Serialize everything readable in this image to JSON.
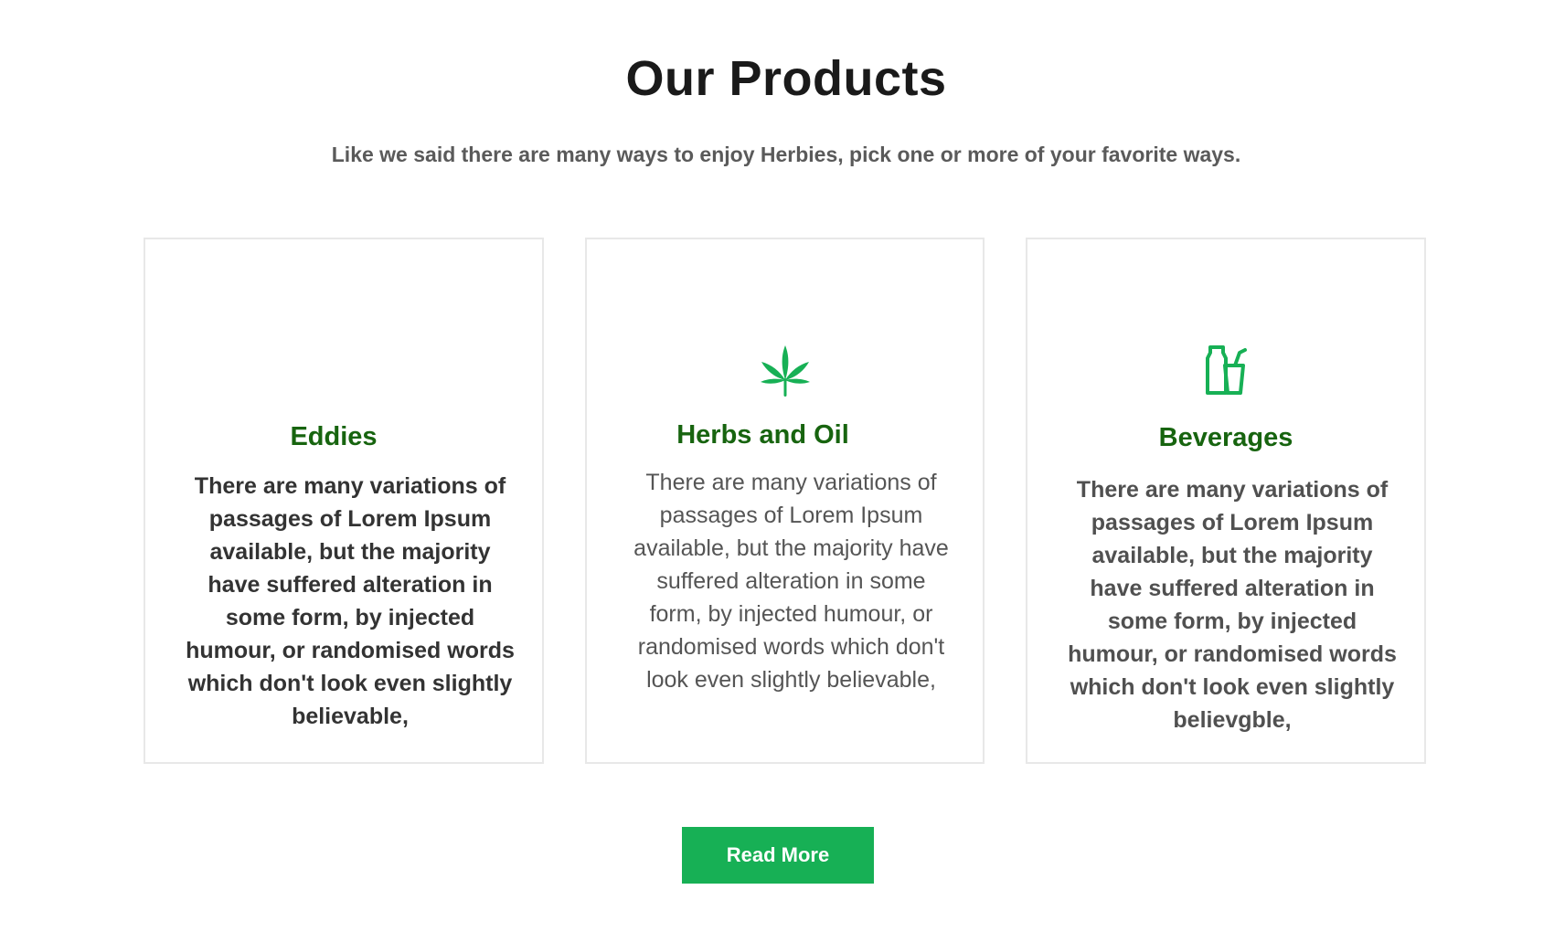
{
  "header": {
    "title": "Our Products",
    "subtitle": "Like we said there are many ways to enjoy Herbies, pick one or more of your favorite ways."
  },
  "colors": {
    "accent": "#17b055",
    "card_title": "#17640f"
  },
  "products": [
    {
      "icon": "none",
      "title": "Eddies",
      "description": "There are many variations of passages of Lorem Ipsum available, but the majority have suffered alteration in some form, by injected humour, or randomised words which don't look even slightly believable,"
    },
    {
      "icon": "cannabis-leaf-icon",
      "title": "Herbs and Oil",
      "description": "There are many variations of passages of Lorem Ipsum available, but the majority have suffered alteration in some form, by injected humour, or randomised words which don't look even slightly believable,"
    },
    {
      "icon": "beverage-bottle-cup-icon",
      "title": "Beverages",
      "description": "There are many variations of passages of Lorem Ipsum available, but the majority have suffered alteration in some form, by injected humour, or randomised words which don't look even slightly believgble,"
    }
  ],
  "actions": {
    "read_more_label": "Read More"
  }
}
